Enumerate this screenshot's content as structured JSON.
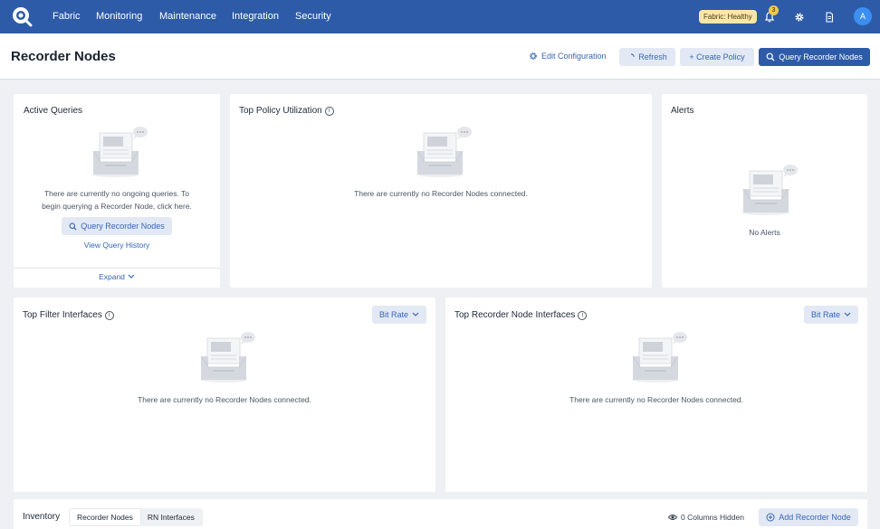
{
  "nav": {
    "items": [
      "Fabric",
      "Monitoring",
      "Maintenance",
      "Integration",
      "Security"
    ],
    "health_badge": "Fabric: Healthy",
    "notification_count": "3",
    "avatar_initial": "A"
  },
  "header": {
    "title": "Recorder Nodes",
    "edit_config": "Edit Configuration",
    "refresh": "Refresh",
    "create_policy": "+ Create Policy",
    "query": "Query Recorder Nodes"
  },
  "cards": {
    "active_queries": {
      "title": "Active Queries",
      "empty_line1": "There are currently no ongoing queries. To",
      "empty_line2": "begin querying a Recorder Node, click here.",
      "button": "Query Recorder Nodes",
      "history_link": "View Query History",
      "expand": "Expand"
    },
    "top_policy": {
      "title": "Top Policy Utilization",
      "empty": "There are currently no Recorder Nodes connected."
    },
    "alerts": {
      "title": "Alerts",
      "empty": "No Alerts"
    },
    "top_filter": {
      "title": "Top Filter Interfaces",
      "dropdown": "Bit Rate",
      "empty": "There are currently no Recorder Nodes connected."
    },
    "top_rn": {
      "title": "Top Recorder Node Interfaces",
      "dropdown": "Bit Rate",
      "empty": "There are currently no Recorder Nodes connected."
    }
  },
  "inventory": {
    "title": "Inventory",
    "tabs": [
      "Recorder Nodes",
      "RN Interfaces"
    ],
    "columns_hidden": "0 Columns Hidden",
    "add_button": "Add Recorder Node"
  },
  "colors": {
    "brand": "#2d5ba8",
    "accent_light": "#e2e9f4",
    "health": "#fbe7a5"
  }
}
